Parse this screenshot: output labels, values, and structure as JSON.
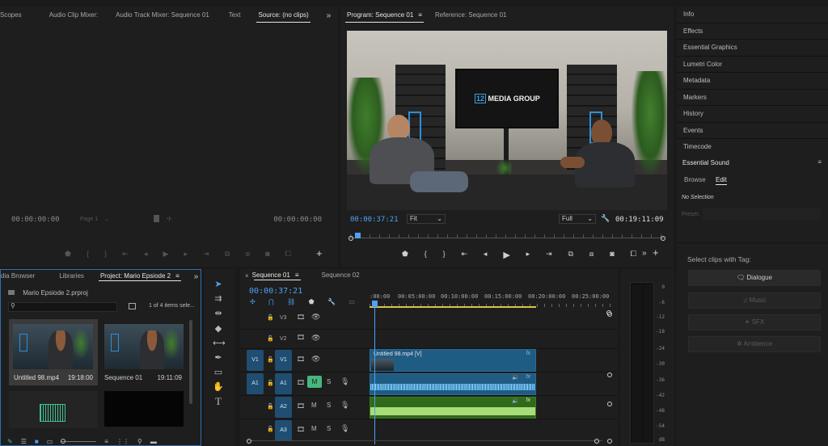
{
  "source_panel": {
    "tabs": [
      "Scopes",
      "Audio Clip Mixer:",
      "Audio Track Mixer: Sequence 01",
      "Text",
      "Source: (no clips)"
    ],
    "overflow_icon": "double-chevron-right",
    "timecode_left": "00:00:00:00",
    "page_label": "Page 1",
    "timecode_right": "00:00:00:00"
  },
  "program_panel": {
    "tabs": [
      "Program: Sequence 01",
      "Reference: Sequence 01"
    ],
    "video_logo_text": "MEDIA GROUP",
    "video_logo_number": "12",
    "timecode": "00:00:37:21",
    "fit_label": "Fit",
    "quality_label": "Full",
    "duration": "00:19:11:09"
  },
  "right_panel": {
    "items": [
      "Info",
      "Effects",
      "Essential Graphics",
      "Lumetri Color",
      "Metadata",
      "Markers",
      "History",
      "Events",
      "Timecode"
    ],
    "essential_sound": {
      "title": "Essential Sound",
      "tabs": [
        "Browse",
        "Edit"
      ],
      "no_selection": "No Selection",
      "preset_label": "Preset:",
      "select_tag_label": "Select clips with Tag:",
      "tags": [
        "Dialogue",
        "Music",
        "SFX",
        "Ambience"
      ]
    }
  },
  "project_panel": {
    "tabs": [
      "dia Browser",
      "Libraries",
      "Project: Mario Epsiode 2"
    ],
    "project_file": "Mario Epsiode 2.prproj",
    "items_count": "1 of 4 items sele...",
    "items": [
      {
        "name": "Untitled 98.mp4",
        "duration": "19:18:00"
      },
      {
        "name": "Sequence 01",
        "duration": "19:11:09"
      }
    ]
  },
  "timeline": {
    "tabs": [
      "Sequence 01",
      "Sequence 02"
    ],
    "timecode": "00:00:37:21",
    "ruler": [
      ":00:00",
      "00:05:00:00",
      "00:10:00:00",
      "00:15:00:00",
      "00:20:00:00",
      "00:25:00:00"
    ],
    "tracks": [
      {
        "id": "V3",
        "kind": "video"
      },
      {
        "id": "V2",
        "kind": "video"
      },
      {
        "id": "V1",
        "kind": "video",
        "source": "V1"
      },
      {
        "id": "A1",
        "kind": "audio",
        "source": "A1"
      },
      {
        "id": "A2",
        "kind": "audio"
      },
      {
        "id": "A3",
        "kind": "audio"
      }
    ],
    "track_mute": "M",
    "track_solo": "S",
    "video_clip_label": "Untitled 98.mp4 [V]",
    "fx_label": "fx"
  },
  "meters": {
    "labels": [
      "0",
      "-6",
      "-12",
      "-18",
      "-24",
      "-30",
      "-36",
      "-42",
      "-48",
      "-54",
      "dB"
    ]
  }
}
